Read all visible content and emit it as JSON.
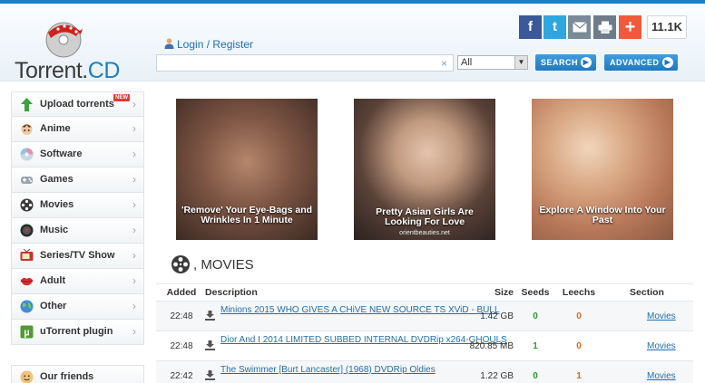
{
  "brand": {
    "name_main": "Torrent.",
    "name_accent": "CD"
  },
  "header": {
    "login_label": "Login / Register",
    "search_value": "",
    "search_clear": "×",
    "category_selected": "All",
    "search_button": "SEARCH",
    "advanced_button": "ADVANCED",
    "share": {
      "fb": "f",
      "tw": "t",
      "plus": "+",
      "count": "11.1K"
    }
  },
  "sidebar": {
    "items": [
      {
        "label": "Upload torrents",
        "icon": "upload-arrow-icon",
        "badge": "NEW"
      },
      {
        "label": "Anime",
        "icon": "anime-icon"
      },
      {
        "label": "Software",
        "icon": "software-disc-icon"
      },
      {
        "label": "Games",
        "icon": "gamepad-icon"
      },
      {
        "label": "Movies",
        "icon": "film-reel-icon"
      },
      {
        "label": "Music",
        "icon": "music-icon"
      },
      {
        "label": "Series/TV Show",
        "icon": "tv-icon"
      },
      {
        "label": "Adult",
        "icon": "lips-icon"
      },
      {
        "label": "Other",
        "icon": "globe-icon"
      },
      {
        "label": "uTorrent plugin",
        "icon": "utorrent-icon"
      }
    ],
    "friends_label": "Our friends",
    "chevron": "›"
  },
  "ads": [
    {
      "caption": "'Remove' Your Eye-Bags and Wrinkles In 1 Minute",
      "source": ""
    },
    {
      "caption": "Pretty Asian Girls Are Looking For Love",
      "source": "orientbeauties.net"
    },
    {
      "caption": "Explore A Window Into Your Past",
      "source": ""
    }
  ],
  "section": {
    "title": ", MOVIES"
  },
  "table": {
    "headers": {
      "added": "Added",
      "description": "Description",
      "size": "Size",
      "seeds": "Seeds",
      "leeches": "Leechs",
      "section": "Section"
    },
    "rows": [
      {
        "added": "22:48",
        "description": "Minions 2015 WHO GIVES A CHiVE NEW SOURCE TS XViD - BULL",
        "size": "1.42 GB",
        "seeds": "0",
        "leeches": "0",
        "section": "Movies"
      },
      {
        "added": "22:48",
        "description": "Dior And I 2014 LIMITED SUBBED INTERNAL DVDRip x264-GHOULS",
        "size": "820.85 MB",
        "seeds": "1",
        "leeches": "0",
        "section": "Movies"
      },
      {
        "added": "22:42",
        "description": "The Swimmer [Burt Lancaster] (1968) DVDRip Oldies",
        "size": "1.22 GB",
        "seeds": "0",
        "leeches": "1",
        "section": "Movies"
      }
    ]
  },
  "colors": {
    "accent": "#1d7fc4",
    "seeds": "#2e9a2e",
    "leech": "#e0651b"
  }
}
